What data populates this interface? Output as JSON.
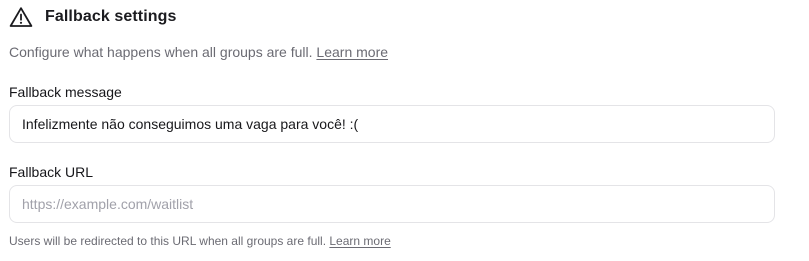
{
  "header": {
    "icon": "warning-triangle-icon",
    "title": "Fallback settings"
  },
  "description": {
    "text": "Configure what happens when all groups are full.",
    "link": "Learn more"
  },
  "fallback_message": {
    "label": "Fallback message",
    "value": "Infelizmente não conseguimos uma vaga para você! :("
  },
  "fallback_url": {
    "label": "Fallback URL",
    "value": "",
    "placeholder": "https://example.com/waitlist"
  },
  "hint": {
    "text": "Users will be redirected to this URL when all groups are full.",
    "link": "Learn more"
  },
  "colors": {
    "text_primary": "#1b1b1f",
    "text_muted": "#6b6b73",
    "border": "#e4e4e7",
    "placeholder": "#a1a1aa"
  }
}
